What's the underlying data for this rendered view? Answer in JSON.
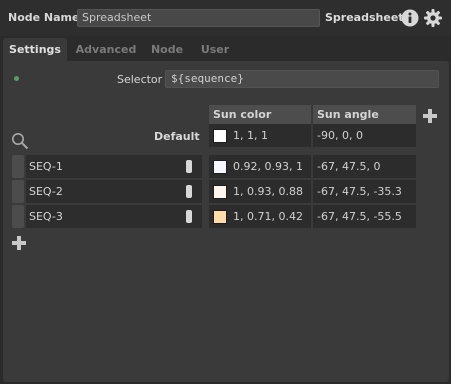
{
  "header": {
    "node_name_label": "Node Name",
    "node_name_value": "Spreadsheet",
    "node_type": "Spreadsheet",
    "info_icon": "info-icon",
    "settings_icon": "gear-icon"
  },
  "tabs": [
    {
      "label": "Settings",
      "active": true
    },
    {
      "label": "Advanced",
      "active": false
    },
    {
      "label": "Node",
      "active": false
    },
    {
      "label": "User",
      "active": false
    }
  ],
  "selector": {
    "label": "Selector",
    "value": "${sequence}"
  },
  "table": {
    "columns": [
      "Sun color",
      "Sun angle"
    ],
    "default_label": "Default",
    "default_row": {
      "sun_color": "1, 1, 1",
      "sun_color_swatch": "#ffffff",
      "sun_angle": "-90, 0, 0"
    },
    "rows": [
      {
        "name": "SEQ-1",
        "sun_color": "0.92, 0.93, 1",
        "sun_color_swatch": "#f5f6ff",
        "sun_angle": "-67, 47.5, 0"
      },
      {
        "name": "SEQ-2",
        "sun_color": "1, 0.93, 0.88",
        "sun_color_swatch": "#fff6f0",
        "sun_angle": "-67, 47.5, -35.3"
      },
      {
        "name": "SEQ-3",
        "sun_color": "1, 0.71, 0.42",
        "sun_color_swatch": "#ffdcaa",
        "sun_angle": "-67, 47.5, -55.5"
      }
    ]
  },
  "icons": {
    "search": "search-icon",
    "add_column": "plus-icon",
    "add_row": "plus-icon"
  }
}
